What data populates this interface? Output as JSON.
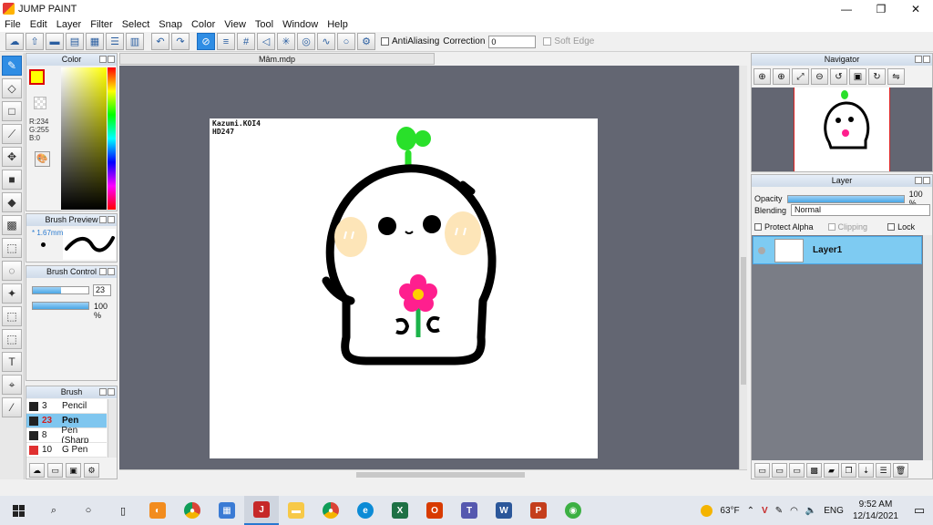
{
  "window": {
    "title": "JUMP PAINT",
    "minimize": "—",
    "maximize": "❐",
    "close": "✕"
  },
  "menu": [
    "File",
    "Edit",
    "Layer",
    "Filter",
    "Select",
    "Snap",
    "Color",
    "View",
    "Tool",
    "Window",
    "Help"
  ],
  "toolbar": {
    "antialiasing_label": "AntiAliasing",
    "correction_label": "Correction",
    "correction_value": "0",
    "soft_edge_label": "Soft Edge"
  },
  "color_panel": {
    "title": "Color",
    "r": "R:234",
    "g": "G:255",
    "b": "B:0",
    "fg_color": "#ffff00"
  },
  "brush_preview": {
    "title": "Brush Preview",
    "size": "* 1.67mm"
  },
  "brush_control": {
    "title": "Brush Control",
    "size_value": "23",
    "opacity_value": "100 %",
    "size_fraction": 0.5,
    "opacity_fraction": 1.0
  },
  "brush_list": {
    "title": "Brush",
    "items": [
      {
        "size": "3",
        "name": "Pencil",
        "color": "#222222"
      },
      {
        "size": "23",
        "name": "Pen",
        "color": "#222222",
        "selected": true
      },
      {
        "size": "8",
        "name": "Pen (Sharp",
        "color": "#222222"
      },
      {
        "size": "10",
        "name": "G Pen",
        "color": "#e03030"
      }
    ]
  },
  "document": {
    "tab": "Mâm.mdp",
    "label_line1": "Kazumi.KOI4",
    "label_line2": "HD247"
  },
  "navigator": {
    "title": "Navigator"
  },
  "layer_panel": {
    "title": "Layer",
    "opacity_label": "Opacity",
    "opacity_value": "100 %",
    "blending_label": "Blending",
    "blending_value": "Normal",
    "protect_alpha": "Protect Alpha",
    "clipping": "Clipping",
    "lock": "Lock",
    "layers": [
      {
        "name": "Layer1",
        "selected": true
      }
    ]
  },
  "taskbar": {
    "weather": "63°F",
    "language": "ENG",
    "time": "9:52 AM",
    "date": "12/14/2021",
    "apps": [
      "search-icon",
      "cortana-icon",
      "task-view-icon",
      "app-orange-icon",
      "chrome-icon",
      "store-icon",
      "jump-paint-icon",
      "file-explorer-icon",
      "chrome-icon",
      "edge-icon",
      "excel-icon",
      "office-icon",
      "teams-icon",
      "word-icon",
      "powerpoint-icon",
      "app-green-icon"
    ]
  }
}
